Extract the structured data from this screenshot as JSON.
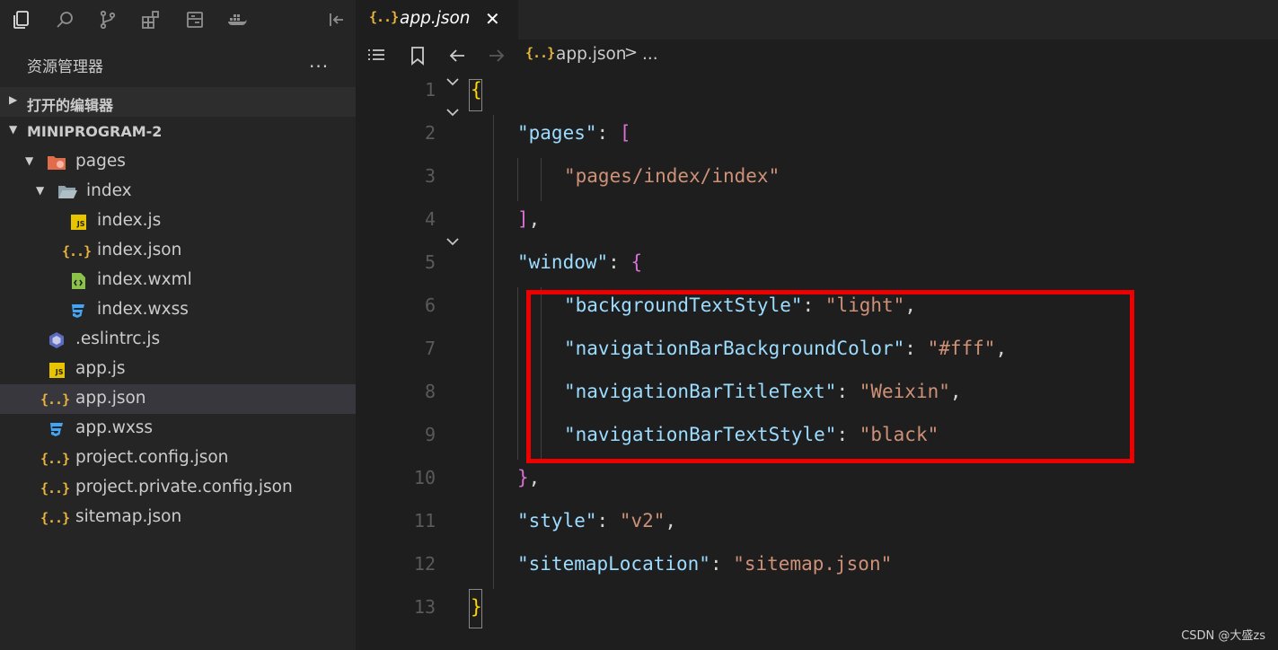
{
  "sidebar": {
    "activity_icons": [
      "explorer-icon",
      "search-icon",
      "source-control-icon",
      "extensions-icon",
      "outline-icon",
      "docker-icon",
      "collapse-sidebar-icon"
    ],
    "explorer_title": "资源管理器",
    "more_label": "...",
    "open_editors_label": "打开的编辑器",
    "project_label": "MINIPROGRAM-2",
    "tree": [
      {
        "name": "pages",
        "type": "folder-pages",
        "expanded": true
      },
      {
        "name": "index",
        "type": "folder",
        "expanded": true
      },
      {
        "name": "index.js",
        "type": "js"
      },
      {
        "name": "index.json",
        "type": "json"
      },
      {
        "name": "index.wxml",
        "type": "wxml"
      },
      {
        "name": "index.wxss",
        "type": "css"
      },
      {
        "name": ".eslintrc.js",
        "type": "eslint"
      },
      {
        "name": "app.js",
        "type": "js"
      },
      {
        "name": "app.json",
        "type": "json",
        "selected": true
      },
      {
        "name": "app.wxss",
        "type": "css"
      },
      {
        "name": "project.config.json",
        "type": "json"
      },
      {
        "name": "project.private.config.json",
        "type": "json"
      },
      {
        "name": "sitemap.json",
        "type": "json"
      }
    ]
  },
  "editor": {
    "tab_label": "app.json",
    "tab_icon_text": "{..}",
    "breadcrumb_file": "app.json",
    "breadcrumb_sep": ">",
    "breadcrumb_more": "...",
    "line_numbers": [
      "1",
      "2",
      "3",
      "4",
      "5",
      "6",
      "7",
      "8",
      "9",
      "10",
      "11",
      "12",
      "13"
    ],
    "code": {
      "l1_open": "{",
      "l2_key": "\"pages\"",
      "l2_colon": ": ",
      "l2_bracket": "[",
      "l3_value": "\"pages/index/index\"",
      "l4_bracket": "]",
      "l4_comma": ",",
      "l5_key": "\"window\"",
      "l5_colon": ": ",
      "l5_brace": "{",
      "l6_key": "\"backgroundTextStyle\"",
      "l6_colon": ": ",
      "l6_value": "\"light\"",
      "l6_comma": ",",
      "l7_key": "\"navigationBarBackgroundColor\"",
      "l7_colon": ": ",
      "l7_value": "\"#fff\"",
      "l7_comma": ",",
      "l8_key": "\"navigationBarTitleText\"",
      "l8_colon": ": ",
      "l8_value": "\"Weixin\"",
      "l8_comma": ",",
      "l9_key": "\"navigationBarTextStyle\"",
      "l9_colon": ": ",
      "l9_value": "\"black\"",
      "l10_brace": "}",
      "l10_comma": ",",
      "l11_key": "\"style\"",
      "l11_colon": ": ",
      "l11_value": "\"v2\"",
      "l11_comma": ",",
      "l12_key": "\"sitemapLocation\"",
      "l12_colon": ": ",
      "l12_value": "\"sitemap.json\"",
      "l13_close": "}"
    }
  },
  "watermark": "CSDN @大盛zs",
  "colors": {
    "highlight_box": "#ee0000",
    "json_key": "#9cdcfe",
    "json_string": "#ce9178",
    "brace": "#ffd700",
    "bracket": "#da70d6"
  }
}
